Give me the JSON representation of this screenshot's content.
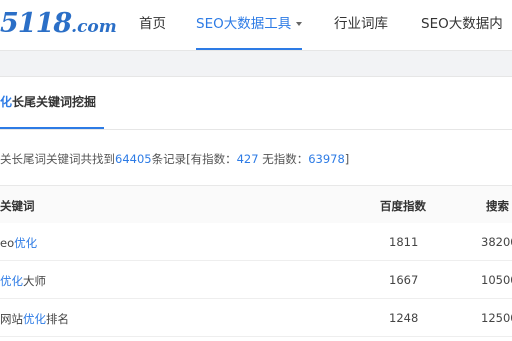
{
  "logo": {
    "number": "5118",
    "domain": ".com"
  },
  "nav": {
    "items": [
      {
        "label": "首页"
      },
      {
        "label": "SEO大数据工具"
      },
      {
        "label": "行业词库"
      },
      {
        "label": "SEO大数据内"
      }
    ]
  },
  "tab": {
    "highlight": "化",
    "label": "长尾关键词挖掘"
  },
  "summary": {
    "prefix": "关长尾词关键词共找到",
    "total": "64405",
    "mid": "条记录[有指数：",
    "indexed": "427",
    "sep": " 无指数：",
    "unindexed": "63978",
    "suffix": "]"
  },
  "table": {
    "headers": [
      "关键词",
      "百度指数",
      "搜索"
    ],
    "rows": [
      {
        "pre": "eo",
        "hl": "优化",
        "post": "",
        "index": "1811",
        "search": "38200"
      },
      {
        "pre": "",
        "hl": "优化",
        "post": "大师",
        "index": "1667",
        "search": "10500"
      },
      {
        "pre": "网站",
        "hl": "优化",
        "post": "排名",
        "index": "1248",
        "search": "12500"
      }
    ]
  },
  "colors": {
    "accent": "#2d7be5",
    "logo": "#2b6fc7"
  }
}
